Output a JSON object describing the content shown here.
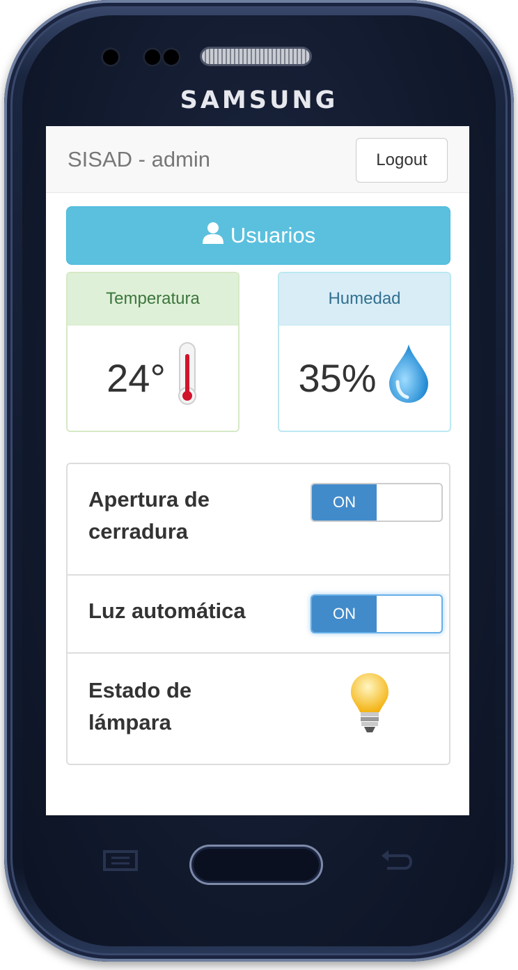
{
  "device": {
    "brand": "SAMSUNG"
  },
  "navbar": {
    "title": "SISAD - admin",
    "logout_label": "Logout"
  },
  "users_button": {
    "label": "Usuarios",
    "icon": "user-icon"
  },
  "sensors": {
    "temperature": {
      "title": "Temperatura",
      "value": "24°",
      "icon": "thermometer-icon"
    },
    "humidity": {
      "title": "Humedad",
      "value": "35%",
      "icon": "water-drop-icon"
    }
  },
  "controls": [
    {
      "label_line1": "Apertura de",
      "label_line2": "cerradura",
      "state": "ON"
    },
    {
      "label": "Luz automática",
      "state": "ON"
    },
    {
      "label_line1": "Estado de",
      "label_line2": "lámpara",
      "icon": "light-bulb-icon"
    }
  ],
  "colors": {
    "info": "#5bc0de",
    "primary": "#428bca",
    "success_bg": "#dff0d8",
    "info_bg": "#d9edf7"
  }
}
